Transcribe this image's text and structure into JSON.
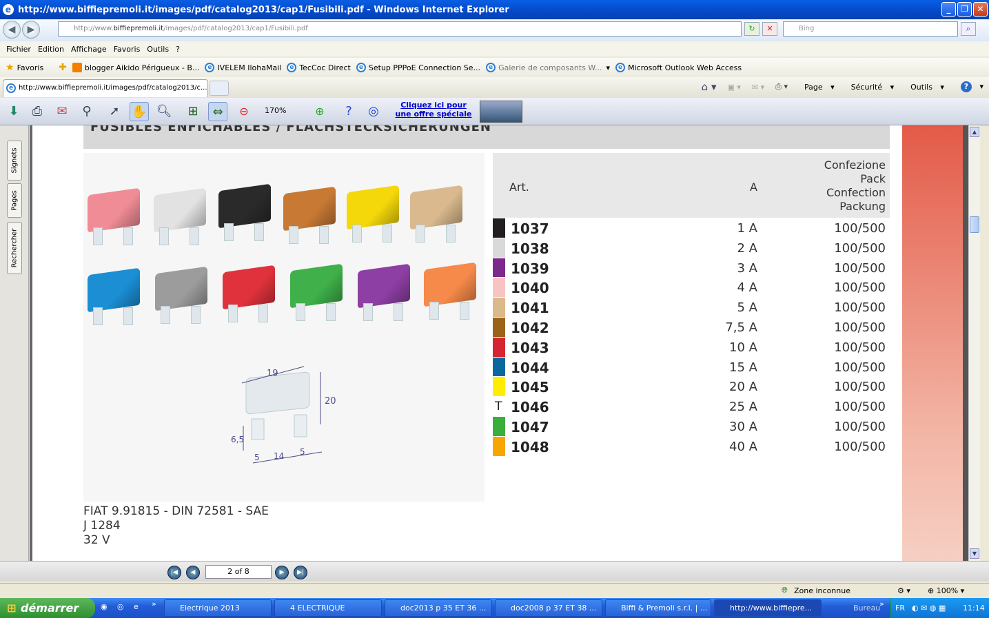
{
  "window": {
    "title": "http://www.biffiepremoli.it/images/pdf/catalog2013/cap1/Fusibili.pdf - Windows Internet Explorer"
  },
  "address": {
    "prefix": "http://www.",
    "domain": "biffiepremoli.it",
    "path": "/images/pdf/catalog2013/cap1/Fusibili.pdf"
  },
  "search": {
    "placeholder": "Bing"
  },
  "menu": [
    "Fichier",
    "Edition",
    "Affichage",
    "Favoris",
    "Outils",
    "?"
  ],
  "favorites": {
    "label": "Favoris",
    "items": [
      "blogger Aikido Périgueux - B...",
      "IVELEM IlohaMail",
      "TecCoc Direct",
      "Setup PPPoE Connection Se...",
      "Galerie de composants W...",
      "Microsoft Outlook Web Access"
    ]
  },
  "tab": {
    "label": "http://www.biffiepremoli.it/images/pdf/catalog2013/c..."
  },
  "commands": {
    "page": "Page",
    "security": "Sécurité",
    "tools": "Outils"
  },
  "pdf_toolbar": {
    "zoom": "170%",
    "promo": "Cliquez ici pour une offre spéciale"
  },
  "side_tabs": [
    "Signets",
    "Pages",
    "Rechercher"
  ],
  "document": {
    "header": "FUSIBLES ENFICHABLES / FLACHSTECKSICHERUNGEN",
    "dimensions": {
      "w": "19",
      "h": "20",
      "leg": "6,5",
      "a": "5",
      "b": "14",
      "c": "5"
    },
    "specs": [
      "FIAT 9.91815 - DIN 72581 - SAE",
      "J 1284",
      "32 V"
    ],
    "table": {
      "col_art": "Art.",
      "col_amp": "A",
      "col_pack": [
        "Confezione",
        "Pack",
        "Confection",
        "Packung"
      ],
      "rows": [
        {
          "art": "1037",
          "amp": "1 A",
          "pack": "100/500",
          "color": "#231f20"
        },
        {
          "art": "1038",
          "amp": "2 A",
          "pack": "100/500",
          "color": "#d9d9d9"
        },
        {
          "art": "1039",
          "amp": "3 A",
          "pack": "100/500",
          "color": "#7b2a8c"
        },
        {
          "art": "1040",
          "amp": "4 A",
          "pack": "100/500",
          "color": "#f7c4c1"
        },
        {
          "art": "1041",
          "amp": "5 A",
          "pack": "100/500",
          "color": "#dcb98a"
        },
        {
          "art": "1042",
          "amp": "7,5 A",
          "pack": "100/500",
          "color": "#9a6318"
        },
        {
          "art": "1043",
          "amp": "10 A",
          "pack": "100/500",
          "color": "#d62532"
        },
        {
          "art": "1044",
          "amp": "15 A",
          "pack": "100/500",
          "color": "#0b689e"
        },
        {
          "art": "1045",
          "amp": "20 A",
          "pack": "100/500",
          "color": "#ffed00"
        },
        {
          "art": "1046",
          "amp": "25 A",
          "pack": "100/500",
          "color": "#ffffff",
          "mark": "T"
        },
        {
          "art": "1047",
          "amp": "30 A",
          "pack": "100/500",
          "color": "#3aae3a"
        },
        {
          "art": "1048",
          "amp": "40 A",
          "pack": "100/500",
          "color": "#f7a600"
        }
      ]
    },
    "fuse_colors": [
      "#f08c96",
      "#e2e2e2",
      "#2a2a2a",
      "#c87a35",
      "#f5d80a",
      "#d9b98d",
      "#1b8ed4",
      "#9c9c9c",
      "#e0323c",
      "#3fb04a",
      "#8d3fa3",
      "#f68a4a"
    ]
  },
  "nav": {
    "page": "2 of 8"
  },
  "status": {
    "zone": "Zone inconnue",
    "zoom": "100%"
  },
  "taskbar": {
    "start": "démarrer",
    "tasks": [
      "Electrique 2013",
      "4 ELECTRIQUE",
      "doc2013 p 35 ET 36 ...",
      "doc2008 p 37 ET 38 ...",
      "Biffi & Premoli s.r.l. | ...",
      "http://www.biffiepre..."
    ],
    "bureau": "Bureau",
    "lang": "FR",
    "time": "11:14"
  }
}
